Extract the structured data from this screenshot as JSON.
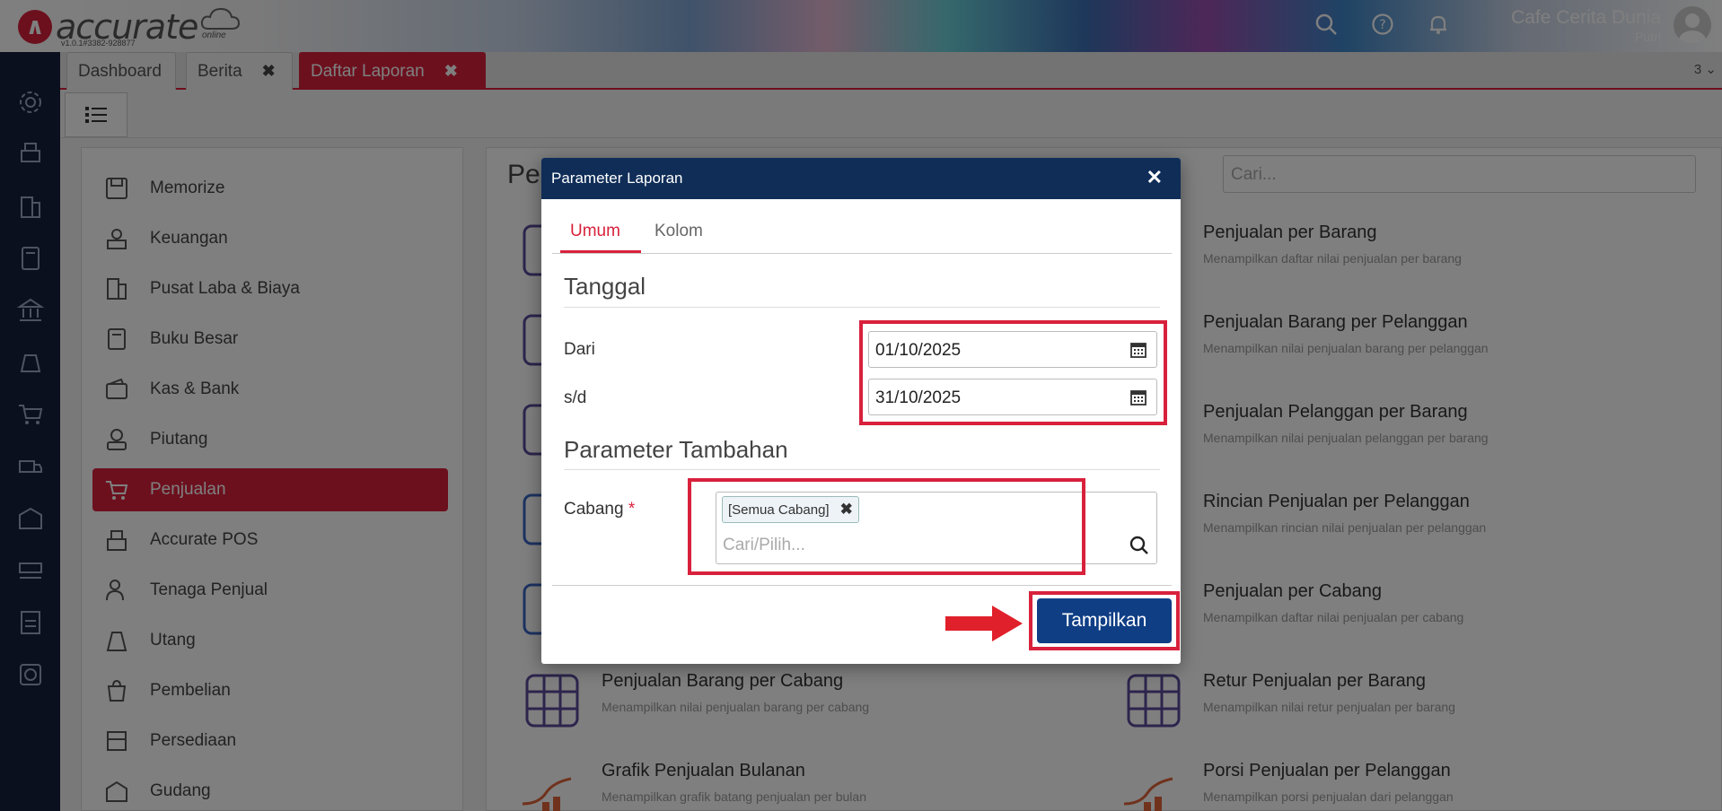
{
  "header": {
    "logo_text": "accurate",
    "logo_sub": "online",
    "version": "v1.0.1#3382-928877",
    "company_name": "Cafe Cerita Dunia",
    "user_name": "Putri",
    "icons": [
      "search-icon",
      "help-icon",
      "bell-icon",
      "avatar"
    ]
  },
  "rail": {
    "icons": [
      "gear-icon",
      "printer-icon",
      "building-icon",
      "book-icon",
      "bank-icon",
      "money-bag-icon",
      "cart-icon",
      "truck-icon",
      "warehouse-icon",
      "conveyor-icon",
      "tax-icon",
      "chart-icon"
    ]
  },
  "tabs": [
    {
      "label": "Dashboard",
      "closable": false,
      "active": false
    },
    {
      "label": "Berita",
      "closable": true,
      "active": false
    },
    {
      "label": "Daftar Laporan",
      "closable": true,
      "active": true
    }
  ],
  "tab_count": "3",
  "menu": {
    "items": [
      {
        "label": "Memorize"
      },
      {
        "label": "Keuangan"
      },
      {
        "label": "Pusat Laba & Biaya"
      },
      {
        "label": "Buku Besar"
      },
      {
        "label": "Kas & Bank"
      },
      {
        "label": "Piutang"
      },
      {
        "label": "Penjualan"
      },
      {
        "label": "Accurate POS"
      },
      {
        "label": "Tenaga Penjual"
      },
      {
        "label": "Utang"
      },
      {
        "label": "Pembelian"
      },
      {
        "label": "Persediaan"
      },
      {
        "label": "Gudang"
      }
    ],
    "active": "Penjualan"
  },
  "content": {
    "title": "Pe",
    "search_placeholder": "Cari...",
    "reports_right": [
      {
        "title": "Penjualan per Barang",
        "desc": "Menampilkan daftar nilai penjualan per barang"
      },
      {
        "title": "Penjualan Barang per Pelanggan",
        "desc": "Menampilkan nilai penjualan barang per pelanggan"
      },
      {
        "title": "Penjualan Pelanggan per Barang",
        "desc": "Menampilkan nilai penjualan pelanggan per barang"
      },
      {
        "title": "Rincian Penjualan per Pelanggan",
        "desc": "Menampilkan rincian nilai penjualan per pelanggan"
      },
      {
        "title": "Penjualan per Cabang",
        "desc": "Menampilkan daftar nilai penjualan per cabang"
      },
      {
        "title": "Retur Penjualan per Barang",
        "desc": "Menampilkan nilai retur penjualan per barang"
      },
      {
        "title": "Porsi Penjualan per Pelanggan",
        "desc": "Menampilkan porsi penjualan dari pelanggan"
      }
    ],
    "reports_left": [
      {
        "title": "Penjualan Barang per Cabang",
        "desc": "Menampilkan nilai penjualan barang per cabang"
      },
      {
        "title": "Grafik Penjualan Bulanan",
        "desc": "Menampilkan grafik batang penjualan per bulan"
      }
    ]
  },
  "modal": {
    "title": "Parameter Laporan",
    "tabs": [
      "Umum",
      "Kolom"
    ],
    "active_tab": "Umum",
    "section_date": "Tanggal",
    "from_label": "Dari",
    "from_value": "01/10/2025",
    "to_label": "s/d",
    "to_value": "31/10/2025",
    "section_extra": "Parameter Tambahan",
    "branch_label": "Cabang",
    "branch_required": "*",
    "branch_chip": "[Semua Cabang]",
    "branch_placeholder": "Cari/Pilih...",
    "submit_label": "Tampilkan"
  },
  "colors": {
    "accent_red": "#d8213c",
    "modal_header": "#0f2d57",
    "primary_button": "#0f3e85",
    "rail": "#14203c"
  }
}
